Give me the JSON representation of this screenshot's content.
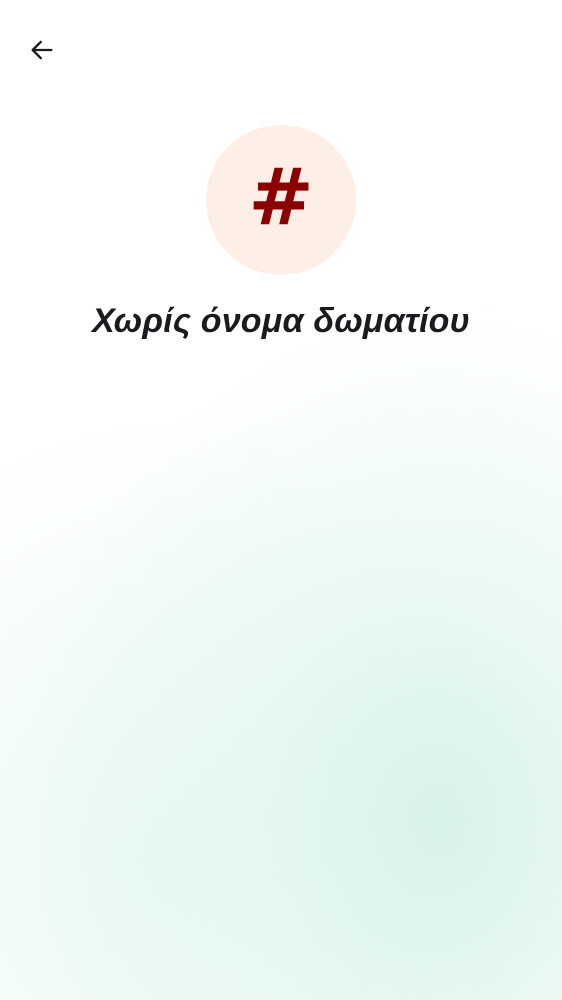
{
  "header": {
    "back_icon": "arrow-left-icon"
  },
  "room": {
    "avatar_glyph": "#",
    "avatar_background": "#fdeee6",
    "avatar_color": "#8b0000",
    "name": "Χωρίς όνομα δωματίου"
  },
  "theme": {
    "background_tint": "#e2f6f0",
    "text_color": "#1b1b1f"
  }
}
